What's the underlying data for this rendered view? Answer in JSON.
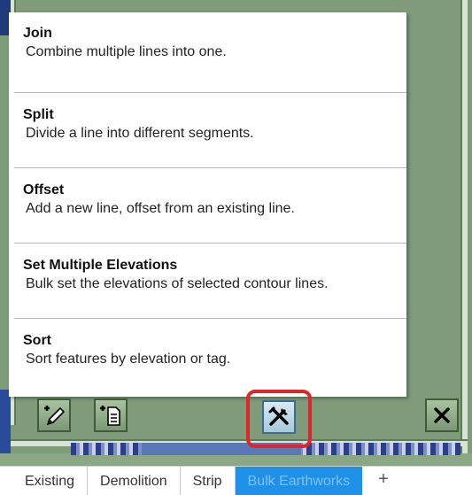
{
  "menu": {
    "items": [
      {
        "title": "Join",
        "description": "Combine multiple lines into one."
      },
      {
        "title": "Split",
        "description": "Divide a line into different segments."
      },
      {
        "title": "Offset",
        "description": "Add a new line, offset from an existing line."
      },
      {
        "title": "Set Multiple Elevations",
        "description": "Bulk set the elevations of selected contour lines."
      },
      {
        "title": "Sort",
        "description": "Sort features by elevation or tag."
      }
    ]
  },
  "toolbar": {
    "buttons": [
      {
        "icon": "add-pencil-icon"
      },
      {
        "icon": "add-document-icon"
      },
      {
        "icon": "tools-icon",
        "active": true
      },
      {
        "icon": "close-icon"
      }
    ],
    "highlight_color": "#e0262d"
  },
  "tabs": {
    "items": [
      "Existing",
      "Demolition",
      "Strip",
      "Bulk Earthworks",
      "+"
    ],
    "active": "Bulk Earthworks",
    "active_color": "#1e90e8"
  }
}
